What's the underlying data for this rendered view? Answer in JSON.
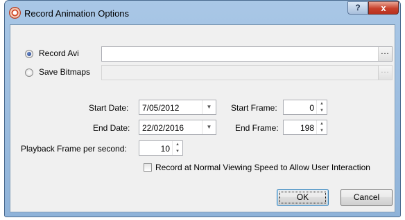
{
  "window": {
    "title": "Record Animation Options",
    "help_label": "?",
    "close_label": "x"
  },
  "record_avi": {
    "label": "Record Avi",
    "path": "",
    "browse_label": "...",
    "selected": true
  },
  "save_bitmaps": {
    "label": "Save Bitmaps",
    "path": "",
    "browse_label": "...",
    "selected": false
  },
  "start_date": {
    "label": "Start Date:",
    "value": "7/05/2012"
  },
  "end_date": {
    "label": "End Date:",
    "value": "22/02/2016"
  },
  "start_frame": {
    "label": "Start Frame:",
    "value": "0"
  },
  "end_frame": {
    "label": "End Frame:",
    "value": "198"
  },
  "playback": {
    "label": "Playback Frame per second:",
    "value": "10"
  },
  "normal_speed": {
    "label": "Record at Normal Viewing Speed to Allow User Interaction",
    "checked": false
  },
  "buttons": {
    "ok": "OK",
    "cancel": "Cancel"
  },
  "icons": {
    "dropdown": "▼",
    "spin_up": "▲",
    "spin_down": "▼"
  }
}
